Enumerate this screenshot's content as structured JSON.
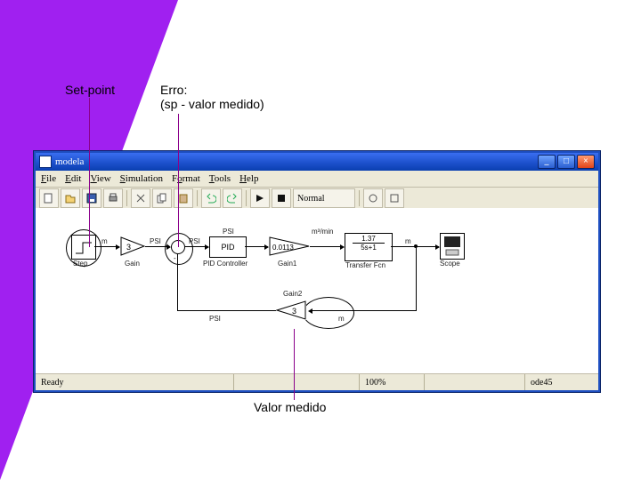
{
  "annotations": {
    "setpoint": "Set-point",
    "erro_line1": "Erro:",
    "erro_line2": " (sp - valor medido)",
    "valor_medido": "Valor medido"
  },
  "window": {
    "title": "modela",
    "menus": [
      "File",
      "Edit",
      "View",
      "Simulation",
      "Format",
      "Tools",
      "Help"
    ],
    "normal": "Normal",
    "status_left": "Ready",
    "status_pct": "100%",
    "status_solver": "ode45"
  },
  "blocks": {
    "step": {
      "label": "Step"
    },
    "gain": {
      "label": "Gain",
      "value": "3"
    },
    "sum": {
      "p1": "+",
      "p2": "-"
    },
    "pid": {
      "label": "PID Controller",
      "text": "PID"
    },
    "gain1": {
      "label": "Gain1",
      "value": "0.0113"
    },
    "tf": {
      "label": "Transfer Fcn",
      "num": "1.37",
      "den": "5s+1"
    },
    "scope": {
      "label": "Scope"
    },
    "gain2": {
      "label": "Gain2",
      "value": "3"
    },
    "signals": {
      "m": "m",
      "psi": "PSI",
      "mcubmin": "m³/min"
    }
  }
}
